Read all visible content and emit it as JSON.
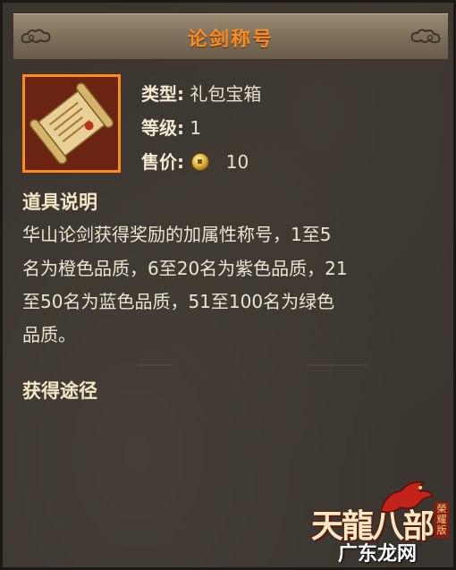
{
  "title": "论剑称号",
  "item": {
    "type_label": "类型:",
    "type_value": "礼包宝箱",
    "level_label": "等级:",
    "level_value": "1",
    "price_label": "售价:",
    "price_value": "10",
    "price_icon": "copper-coin-icon",
    "icon": "scroll-icon"
  },
  "description": {
    "heading": "道具说明",
    "lines": [
      "华山论剑获得奖励的加属性称号，1至5",
      "名为橙色品质，6至20名为紫色品质，21",
      "至50名为蓝色品质，51至100名为绿色",
      "品质。"
    ]
  },
  "obtain": {
    "heading": "获得途径"
  },
  "logo": {
    "main": "天龍八部",
    "sub": "榮耀版",
    "site": "广东龙网"
  },
  "colors": {
    "title": "#ff8a1c",
    "frame_border": "#ff8c1a",
    "text": "#ece4d2",
    "panel_bg": "#3a352f"
  }
}
